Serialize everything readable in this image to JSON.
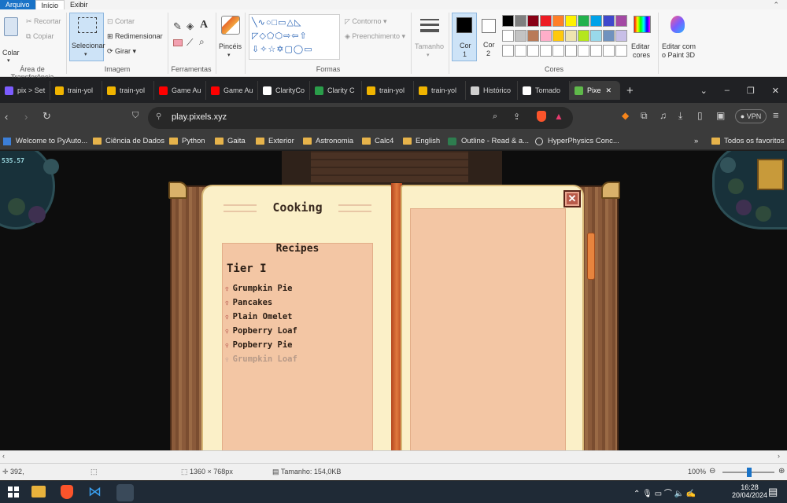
{
  "paint": {
    "menu": [
      "Arquivo",
      "Início",
      "Exibir"
    ],
    "clipboard": {
      "colar": "Colar",
      "recortar": "Recortar",
      "copiar": "Copiar",
      "group": "Área de Transferência"
    },
    "image": {
      "selecionar": "Selecionar",
      "cortar": "Cortar",
      "redimensionar": "Redimensionar",
      "girar": "Girar",
      "group": "Imagem"
    },
    "tools": {
      "group": "Ferramentas",
      "text_tool": "A"
    },
    "brushes": {
      "label": "Pincéis"
    },
    "shapes": {
      "contorno": "Contorno",
      "preenchimento": "Preenchimento",
      "group": "Formas"
    },
    "size": {
      "label": "Tamanho"
    },
    "colors": {
      "cor1_a": "Cor",
      "cor1_b": "1",
      "cor2_a": "Cor",
      "cor2_b": "2",
      "editar_a": "Editar",
      "editar_b": "cores",
      "paint3d_a": "Editar com",
      "paint3d_b": "o Paint 3D",
      "group": "Cores",
      "palette_row1": [
        "#000000",
        "#7f7f7f",
        "#880015",
        "#ed1c24",
        "#ff7f27",
        "#fff200",
        "#22b14c",
        "#00a2e8",
        "#3f48cc",
        "#a349a4"
      ],
      "palette_row2": [
        "#ffffff",
        "#c3c3c3",
        "#b97a57",
        "#ffaec9",
        "#ffc90e",
        "#efe4b0",
        "#b5e61d",
        "#99d9ea",
        "#7092be",
        "#c8bfe7"
      ]
    },
    "status": {
      "position": "392,",
      "dimensions": "1360 × 768px",
      "size": "Tamanho: 154,0KB",
      "zoom": "100%"
    }
  },
  "browser": {
    "tabs": [
      {
        "label": "pix > Set",
        "color": "#7c5cff"
      },
      {
        "label": "train-yol",
        "color": "#f0b400"
      },
      {
        "label": "train-yol",
        "color": "#f0b400"
      },
      {
        "label": "Game Au",
        "color": "#ff0000"
      },
      {
        "label": "Game Au",
        "color": "#ff0000"
      },
      {
        "label": "ClarityCo",
        "color": "#ffffff"
      },
      {
        "label": "Clarity C",
        "color": "#2a9d4a"
      },
      {
        "label": "train-yol",
        "color": "#f0b400"
      },
      {
        "label": "train-yol",
        "color": "#f0b400"
      },
      {
        "label": "Histórico",
        "color": "#cfcfcf"
      },
      {
        "label": "Tomado",
        "color": "#ffffff"
      },
      {
        "label": "Pixe",
        "color": "#5fb94a",
        "active": true
      }
    ],
    "url": "play.pixels.xyz",
    "vpn": "VPN",
    "bookmarks": [
      "Welcome to PyAuto...",
      "Ciência de Dados",
      "Python",
      "Gaita",
      "Exterior",
      "Astronomia",
      "Calc4",
      "English",
      "Outline - Read & a...",
      "HyperPhysics Conc..."
    ],
    "bookmarks_more": "»",
    "all_bookmarks": "Todos os favoritos"
  },
  "game": {
    "hud_coins": "535.57",
    "book": {
      "title": "Cooking",
      "subtitle": "Recipes",
      "tier": "Tier I",
      "recipes": [
        {
          "name": "Grumpkin Pie",
          "enabled": true
        },
        {
          "name": "Pancakes",
          "enabled": true
        },
        {
          "name": "Plain Omelet",
          "enabled": true
        },
        {
          "name": "Popberry Loaf",
          "enabled": true
        },
        {
          "name": "Popberry Pie",
          "enabled": true
        },
        {
          "name": "Grumpkin Loaf",
          "enabled": false
        }
      ],
      "close_icon": "close-icon"
    }
  },
  "taskbar": {
    "time": "16:28",
    "date": "20/04/2024"
  }
}
